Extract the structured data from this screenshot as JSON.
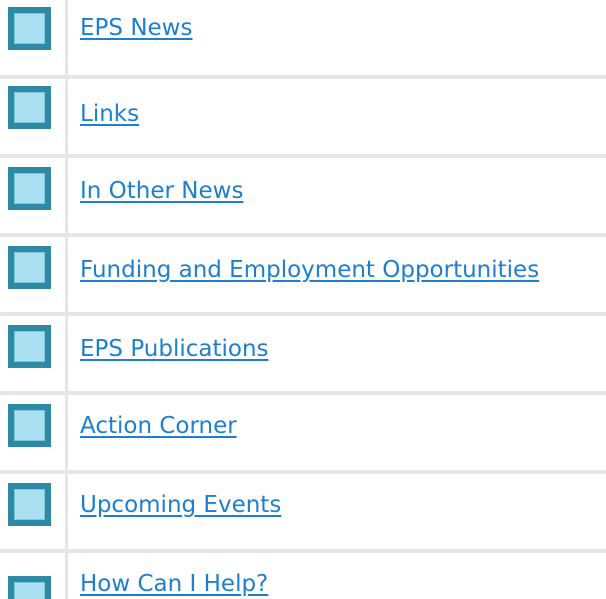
{
  "menu": {
    "items": [
      {
        "label": "EPS News",
        "icon": "square-bullet-icon"
      },
      {
        "label": "Links",
        "icon": "square-bullet-icon"
      },
      {
        "label": "In Other News",
        "icon": "square-bullet-icon"
      },
      {
        "label": "Funding and Employment Opportunities",
        "icon": "square-bullet-icon"
      },
      {
        "label": "EPS Publications",
        "icon": "square-bullet-icon"
      },
      {
        "label": "Action Corner",
        "icon": "square-bullet-icon"
      },
      {
        "label": "Upcoming Events",
        "icon": "square-bullet-icon"
      },
      {
        "label": "How Can I Help?",
        "icon": "square-bullet-icon"
      }
    ]
  },
  "colors": {
    "link": "#1e7fd0",
    "bullet_fill": "#a9dff0",
    "bullet_border": "#2e8aa4",
    "divider": "#e6e6e6"
  }
}
